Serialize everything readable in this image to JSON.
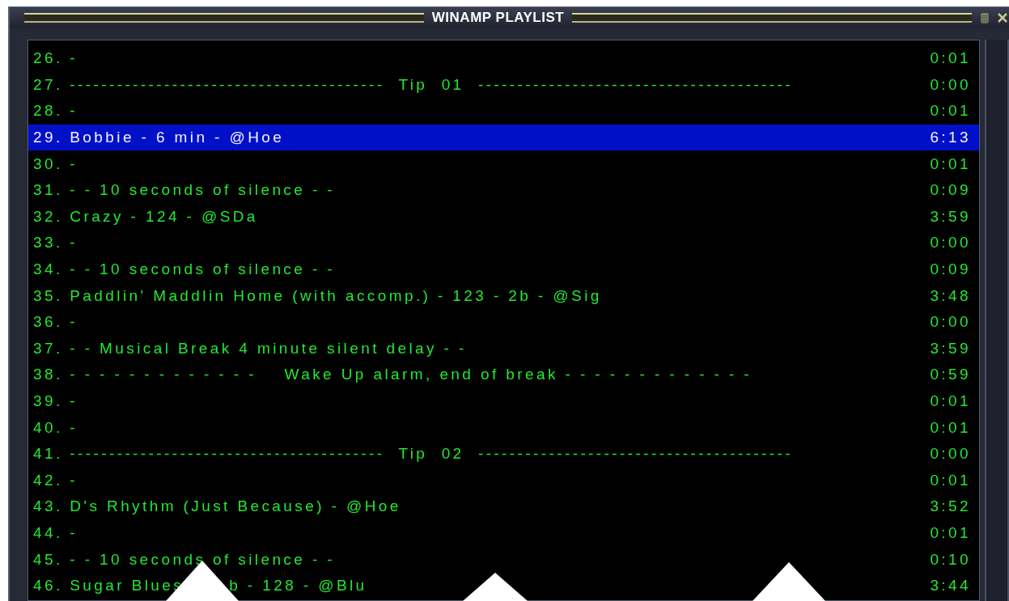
{
  "window": {
    "title": "WINAMP PLAYLIST"
  },
  "rows": [
    {
      "title": "26. -",
      "duration": "0:01",
      "selected": false
    },
    {
      "title": "27. ----------------------------------------  Tip  01  ----------------------------------------",
      "duration": "0:00",
      "selected": false
    },
    {
      "title": "28. -",
      "duration": "0:01",
      "selected": false
    },
    {
      "title": "29. Bobbie - 6 min - @Hoe",
      "duration": "6:13",
      "selected": true
    },
    {
      "title": "30. -",
      "duration": "0:01",
      "selected": false
    },
    {
      "title": "31. - - 10 seconds of silence - -",
      "duration": "0:09",
      "selected": false
    },
    {
      "title": "32. Crazy - 124 - @SDa",
      "duration": "3:59",
      "selected": false
    },
    {
      "title": "33. -",
      "duration": "0:00",
      "selected": false
    },
    {
      "title": "34. - - 10 seconds of silence - -",
      "duration": "0:09",
      "selected": false
    },
    {
      "title": "35. Paddlin' Maddlin Home (with accomp.) - 123 - 2b - @Sig",
      "duration": "3:48",
      "selected": false
    },
    {
      "title": "36. -",
      "duration": "0:00",
      "selected": false
    },
    {
      "title": "37. - - Musical Break 4 minute silent delay - -",
      "duration": "3:59",
      "selected": false
    },
    {
      "title": "38. - - - - - - - - - - - - -    Wake Up alarm, end of break - - - - - - - - - - - - -",
      "duration": "0:59",
      "selected": false
    },
    {
      "title": "39. -",
      "duration": "0:01",
      "selected": false
    },
    {
      "title": "40. -",
      "duration": "0:01",
      "selected": false
    },
    {
      "title": "41. ----------------------------------------  Tip  02  ----------------------------------------",
      "duration": "0:00",
      "selected": false
    },
    {
      "title": "42. -",
      "duration": "0:01",
      "selected": false
    },
    {
      "title": "43. D's Rhythm (Just Because) - @Hoe",
      "duration": "3:52",
      "selected": false
    },
    {
      "title": "44. -",
      "duration": "0:01",
      "selected": false
    },
    {
      "title": "45. - - 10 seconds of silence - -",
      "duration": "0:10",
      "selected": false
    },
    {
      "title": "46. Sugar Blues",
      "title_after_gap": "b - 128 - @Blu",
      "duration": "3:44",
      "selected": false
    }
  ]
}
